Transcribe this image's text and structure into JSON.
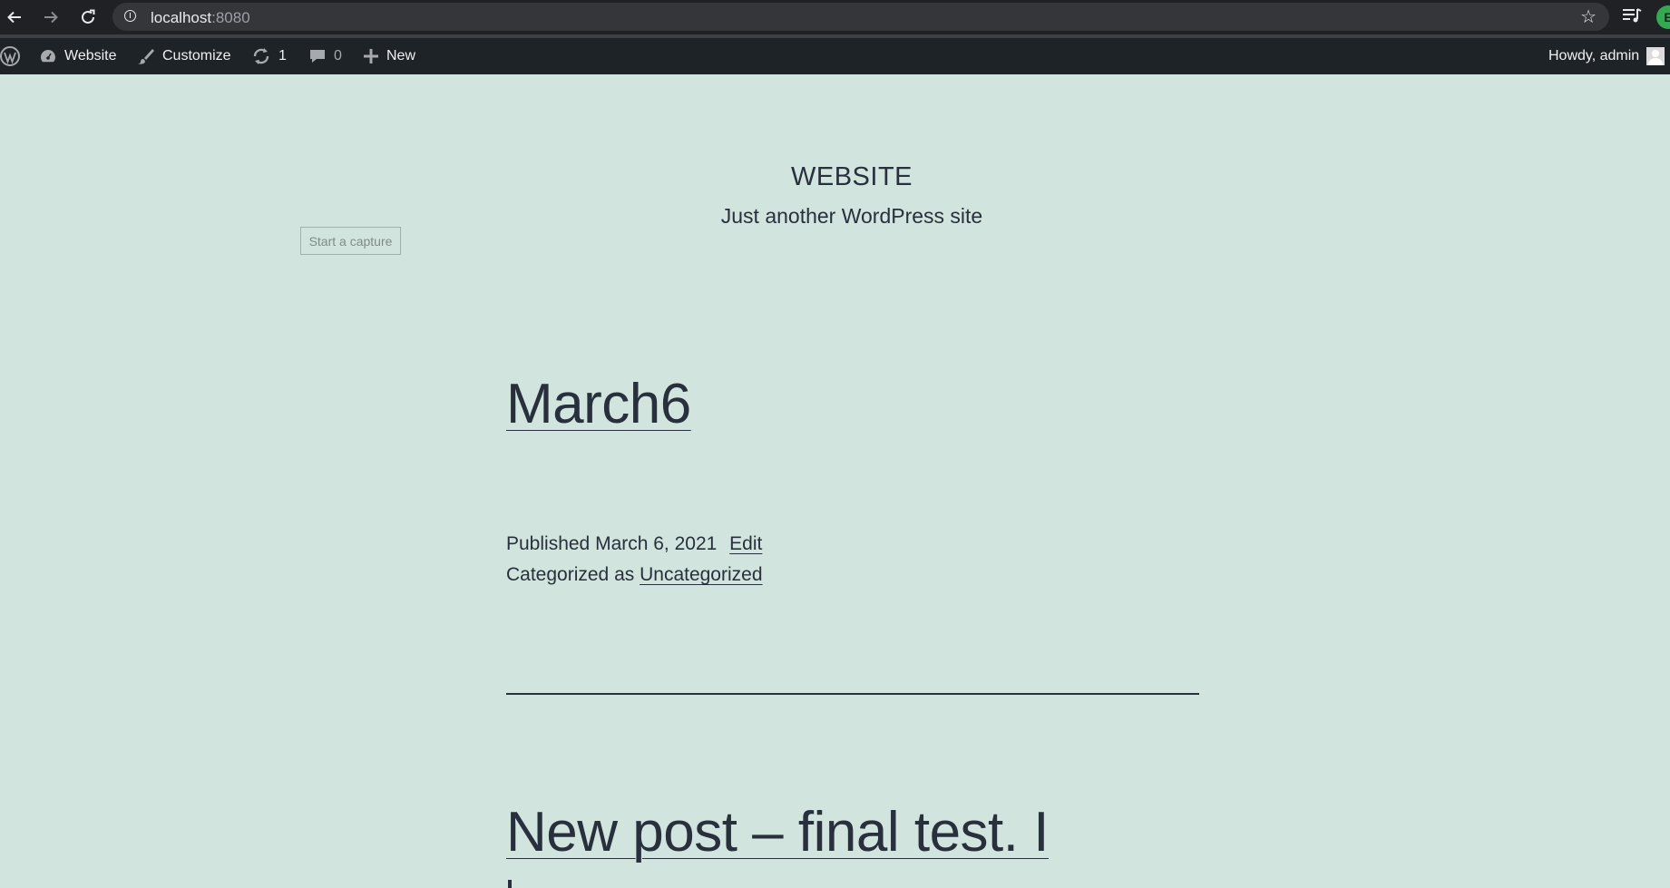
{
  "browser": {
    "url_host": "localhost",
    "url_port": ":8080",
    "back_icon": "arrow-left-icon",
    "forward_icon": "arrow-right-icon",
    "reload_icon": "reload-icon",
    "profile_initial": "E"
  },
  "adminbar": {
    "wp_logo": "wordpress-logo-icon",
    "site_label": "Website",
    "customize_label": "Customize",
    "updates_count": "1",
    "comments_count": "0",
    "new_label": "New",
    "howdy": "Howdy, admin"
  },
  "site": {
    "title": "WEBSITE",
    "description": "Just another WordPress site"
  },
  "capture_button": "Start a capture",
  "posts": [
    {
      "title": "March6",
      "published_prefix": "Published",
      "published_date": "March 6, 2021",
      "edit_label": "Edit",
      "category_prefix": "Categorized as",
      "category": "Uncategorized"
    },
    {
      "title": "New post – final test. I"
    }
  ],
  "colors": {
    "background": "#d1e4dd",
    "text": "#28303d",
    "adminbar": "#1d2327",
    "browser": "#202124"
  }
}
